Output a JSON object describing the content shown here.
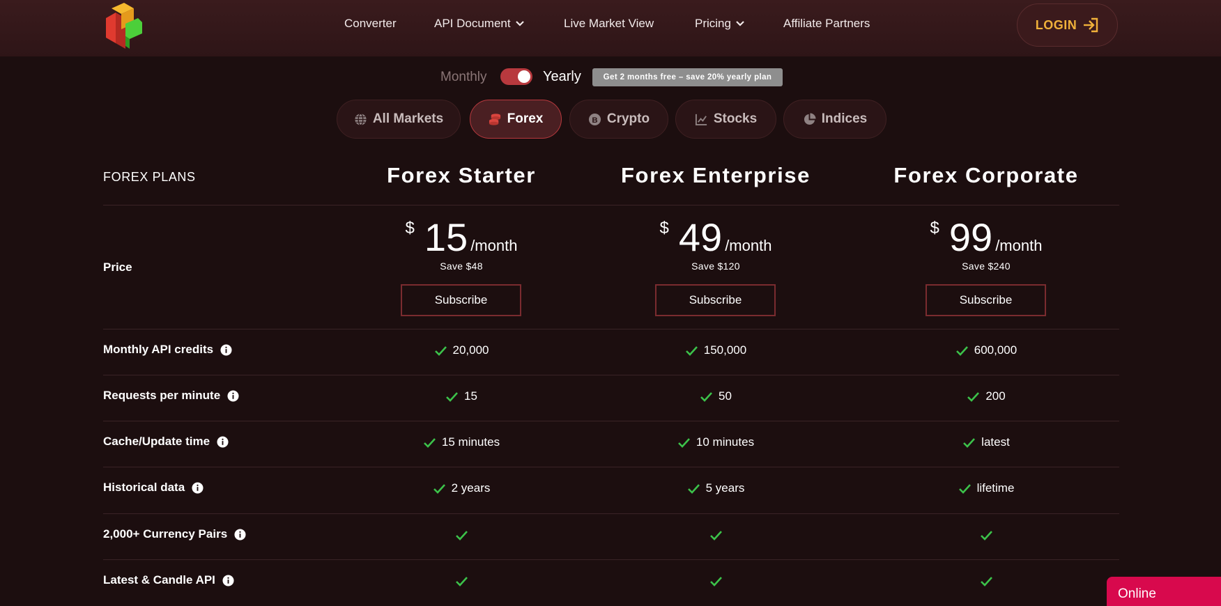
{
  "nav": {
    "items": [
      "Converter",
      "API Document",
      "Live Market View",
      "Pricing",
      "Affiliate Partners"
    ],
    "login_label": "LOGIN"
  },
  "billing": {
    "monthly_label": "Monthly",
    "yearly_label": "Yearly",
    "promo": "Get 2 months free – save 20% yearly plan"
  },
  "tabs": [
    {
      "label": "All Markets",
      "icon": "globe-icon"
    },
    {
      "label": "Forex",
      "icon": "coins-icon"
    },
    {
      "label": "Crypto",
      "icon": "bitcoin-icon"
    },
    {
      "label": "Stocks",
      "icon": "line-chart-icon"
    },
    {
      "label": "Indices",
      "icon": "pie-chart-icon"
    }
  ],
  "table": {
    "section_title": "FOREX PLANS",
    "price_label": "Price",
    "plans": [
      {
        "name": "Forex Starter",
        "currency": "$",
        "amount": "15",
        "period": "/month",
        "save": "Save $48",
        "button": "Subscribe"
      },
      {
        "name": "Forex Enterprise",
        "currency": "$",
        "amount": "49",
        "period": "/month",
        "save": "Save $120",
        "button": "Subscribe"
      },
      {
        "name": "Forex Corporate",
        "currency": "$",
        "amount": "99",
        "period": "/month",
        "save": "Save $240",
        "button": "Subscribe"
      }
    ],
    "features": [
      {
        "label": "Monthly API credits",
        "values": [
          "20,000",
          "150,000",
          "600,000"
        ]
      },
      {
        "label": "Requests per minute",
        "values": [
          "15",
          "50",
          "200"
        ]
      },
      {
        "label": "Cache/Update time",
        "values": [
          "15 minutes",
          "10 minutes",
          "latest"
        ]
      },
      {
        "label": "Historical data",
        "values": [
          "2 years",
          "5 years",
          "lifetime"
        ]
      },
      {
        "label": "2,000+ Currency Pairs",
        "values": [
          "",
          "",
          ""
        ]
      },
      {
        "label": "Latest & Candle API",
        "values": [
          "",
          "",
          ""
        ]
      }
    ]
  },
  "chat": {
    "status": "Online"
  },
  "colors": {
    "accent": "#b8393e",
    "login_text": "#f0b13a",
    "check": "#3cc24a",
    "chat": "#d8094d"
  }
}
